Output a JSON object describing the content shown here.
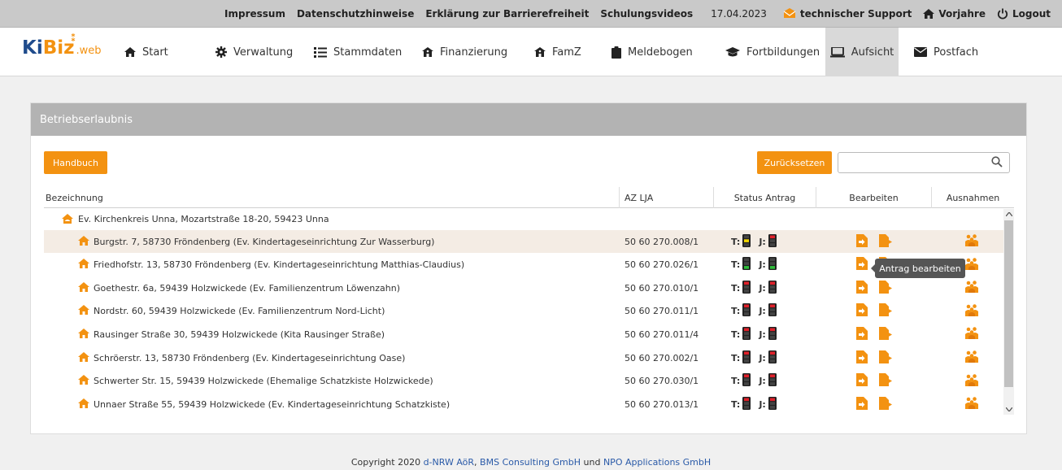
{
  "topbar": {
    "links": [
      "Impressum",
      "Datenschutzhinweise",
      "Erklärung zur Barrierefreiheit",
      "Schulungsvideos"
    ],
    "date": "17.04.2023",
    "support": "technischer Support",
    "vorjahre": "Vorjahre",
    "logout": "Logout"
  },
  "logo": {
    "part1": "Ki",
    "part2": "Biz",
    "part3": ".web"
  },
  "nav": [
    {
      "label": "Start",
      "icon": "home-icon"
    },
    {
      "label": "Verwaltung",
      "icon": "gear-icon"
    },
    {
      "label": "Stammdaten",
      "icon": "list-icon"
    },
    {
      "label": "Finanzierung",
      "icon": "bank-icon"
    },
    {
      "label": "FamZ",
      "icon": "family-home-icon"
    },
    {
      "label": "Meldebogen",
      "icon": "clipboard-icon"
    },
    {
      "label": "Fortbildungen",
      "icon": "graduation-cap-icon"
    },
    {
      "label": "Aufsicht",
      "icon": "laptop-icon",
      "active": true
    },
    {
      "label": "Postfach",
      "icon": "envelope-icon"
    }
  ],
  "panel": {
    "title": "Betriebserlaubnis",
    "handbuch": "Handbuch",
    "reset": "Zurücksetzen",
    "search_value": ""
  },
  "table": {
    "headers": {
      "name": "Bezeichnung",
      "az": "AZ LJA",
      "status": "Status Antrag",
      "edit": "Bearbeiten",
      "exc": "Ausnahmen"
    },
    "group": "Ev. Kirchenkreis Unna, Mozartstraße 18-20, 59423 Unna",
    "status_t": "T:",
    "status_j": "J:",
    "rows": [
      {
        "name": "Burgstr. 7, 58730 Fröndenberg (Ev. Kindertageseinrichtung Zur Wasserburg)",
        "az": "50 60 270.008/1",
        "t": "yellow",
        "j": "red"
      },
      {
        "name": "Friedhofstr. 13, 58730 Fröndenberg (Ev. Kindertageseinrichtung Matthias-Claudius)",
        "az": "50 60 270.026/1",
        "t": "green",
        "j": "green"
      },
      {
        "name": "Goethestr. 6a, 59439 Holzwickede (Ev. Familienzentrum Löwenzahn)",
        "az": "50 60 270.010/1",
        "t": "red",
        "j": "red"
      },
      {
        "name": "Nordstr. 60, 59439 Holzwickede (Ev. Familienzentrum Nord-Licht)",
        "az": "50 60 270.011/1",
        "t": "red",
        "j": "red"
      },
      {
        "name": "Rausinger Straße 30, 59439 Holzwickede (Kita Rausinger Straße)",
        "az": "50 60 270.011/4",
        "t": "red",
        "j": "red"
      },
      {
        "name": "Schröerstr. 13, 58730 Fröndenberg (Ev. Kindertageseinrichtung Oase)",
        "az": "50 60 270.002/1",
        "t": "red",
        "j": "red"
      },
      {
        "name": "Schwerter Str. 15, 59439 Holzwickede (Ehemalige Schatzkiste Holzwickede)",
        "az": "50 60 270.030/1",
        "t": "red",
        "j": "red"
      },
      {
        "name": "Unnaer Straße 55, 59439 Holzwickede (Ev. Kindertageseinrichtung Schatzkiste)",
        "az": "50 60 270.013/1",
        "t": "red",
        "j": "red"
      }
    ]
  },
  "tooltip": "Antrag bearbeiten",
  "footer": {
    "prefix": "Copyright 2020 ",
    "org1": "d-NRW AöR",
    "sep1": ", ",
    "org2": "BMS Consulting GmbH",
    "sep2": " und ",
    "org3": "NPO Applications GmbH"
  },
  "colors": {
    "accent": "#f39211",
    "brand_blue": "#1f4b8c",
    "traffic_red": "#e0202a",
    "traffic_yellow": "#f2d600",
    "traffic_green": "#2fbf3a"
  }
}
